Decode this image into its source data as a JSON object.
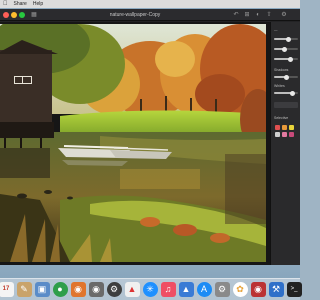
{
  "menubar": {
    "apple_icon": "apple-logo-icon",
    "items": [
      "Share",
      "Help"
    ]
  },
  "window": {
    "title": "nature-wallpaper-Copy",
    "colors": {
      "close": "#ff5f57",
      "minimize": "#febc2e",
      "zoom": "#28c840"
    }
  },
  "sidebar": {
    "sections": [
      "Shadows",
      "Whites",
      "Selective"
    ]
  },
  "dock": {
    "calendar_day": "17",
    "items": [
      {
        "name": "finder",
        "icon": "finder-icon",
        "color": "#3b8ee8"
      },
      {
        "name": "calendar",
        "icon": "calendar-icon",
        "color": "#f4f4f4"
      },
      {
        "name": "notes",
        "icon": "notes-icon",
        "color": "#c9a36a"
      },
      {
        "name": "preview",
        "icon": "preview-icon",
        "color": "#5a8cc8"
      },
      {
        "name": "photo-app",
        "icon": "photo-app-icon",
        "color": "#2f9e4a"
      },
      {
        "name": "photo-editor",
        "icon": "photo-editor-icon",
        "color": "#e0752d"
      },
      {
        "name": "image-viewer",
        "icon": "image-viewer-icon",
        "color": "#6a6a6a"
      },
      {
        "name": "settings",
        "icon": "settings-icon",
        "color": "#3e3e3e"
      },
      {
        "name": "pixelmator",
        "icon": "pixelmator-icon",
        "color": "#f0f0f0"
      },
      {
        "name": "safari",
        "icon": "safari-icon",
        "color": "#1e90ff"
      },
      {
        "name": "music",
        "icon": "music-icon",
        "color": "#ef4e64"
      },
      {
        "name": "keynote",
        "icon": "keynote-icon",
        "color": "#3a7bd5"
      },
      {
        "name": "app-store",
        "icon": "app-store-icon",
        "color": "#1c8cf5"
      },
      {
        "name": "system-preferences",
        "icon": "system-preferences-icon",
        "color": "#8a8a8a"
      },
      {
        "name": "photos",
        "icon": "photos-icon",
        "color": "#ffffff"
      },
      {
        "name": "photo-booth",
        "icon": "photo-booth-icon",
        "color": "#b33"
      },
      {
        "name": "xcode",
        "icon": "xcode-icon",
        "color": "#2f70c9"
      },
      {
        "name": "terminal",
        "icon": "terminal-icon",
        "color": "#222222"
      }
    ]
  }
}
